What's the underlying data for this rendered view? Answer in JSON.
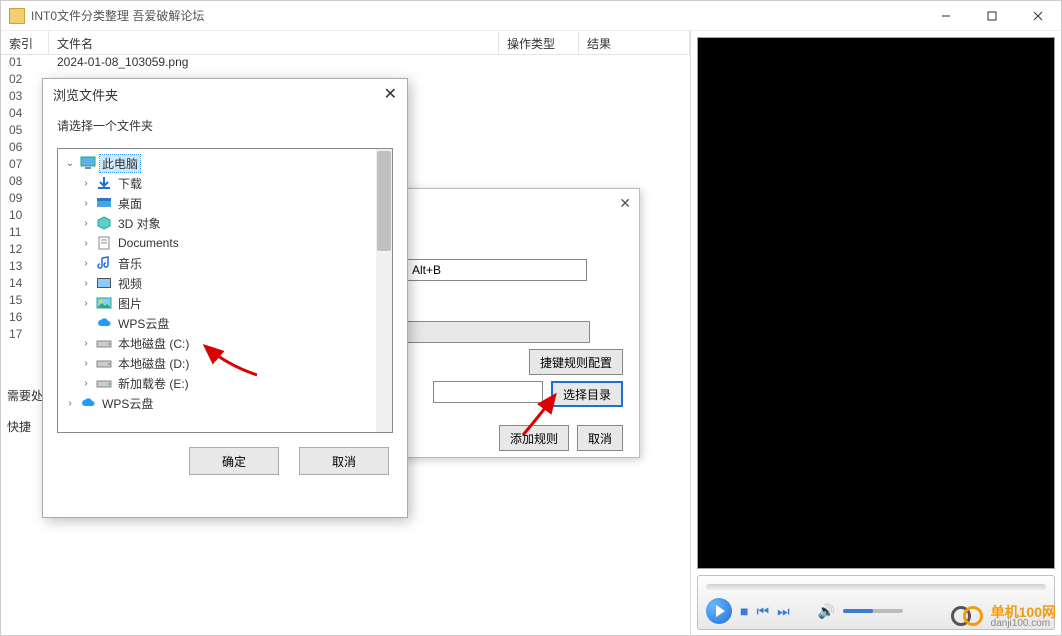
{
  "window": {
    "title": "INT0文件分类整理 吾爱破解论坛"
  },
  "file_table": {
    "headers": {
      "index": "索引",
      "name": "文件名",
      "op": "操作类型",
      "result": "结果"
    },
    "rows": [
      {
        "idx": "01",
        "name": "2024-01-08_103059.png"
      },
      {
        "idx": "02",
        "name": ""
      },
      {
        "idx": "03",
        "name": ""
      },
      {
        "idx": "04",
        "name": ""
      },
      {
        "idx": "05",
        "name": ""
      },
      {
        "idx": "06",
        "name": ""
      },
      {
        "idx": "07",
        "name": ""
      },
      {
        "idx": "08",
        "name": ""
      },
      {
        "idx": "09",
        "name": ""
      },
      {
        "idx": "10",
        "name": ""
      },
      {
        "idx": "11",
        "name": ""
      },
      {
        "idx": "12",
        "name": ""
      },
      {
        "idx": "13",
        "name": ""
      },
      {
        "idx": "14",
        "name": ""
      },
      {
        "idx": "15",
        "name": ""
      },
      {
        "idx": "16",
        "name": ""
      },
      {
        "idx": "17",
        "name": ""
      }
    ]
  },
  "labels": {
    "need_process": "需要处",
    "shortcut": "快捷"
  },
  "under_dialog": {
    "hotkey_value": "Alt+B",
    "rule_config_btn": "捷键规则配置",
    "select_dir_btn": "选择目录",
    "add_rule_btn": "添加规则",
    "cancel_btn": "取消"
  },
  "folder_dialog": {
    "title": "浏览文件夹",
    "subtitle": "请选择一个文件夹",
    "ok": "确定",
    "cancel": "取消",
    "tree": [
      {
        "label": "此电脑",
        "level": 0,
        "expanded": true,
        "icon": "computer",
        "selected": true
      },
      {
        "label": "下载",
        "level": 1,
        "expanded": false,
        "icon": "download"
      },
      {
        "label": "桌面",
        "level": 1,
        "expanded": false,
        "icon": "desktop"
      },
      {
        "label": "3D 对象",
        "level": 1,
        "expanded": false,
        "icon": "3d"
      },
      {
        "label": "Documents",
        "level": 1,
        "expanded": false,
        "icon": "doc"
      },
      {
        "label": "音乐",
        "level": 1,
        "expanded": false,
        "icon": "music"
      },
      {
        "label": "视频",
        "level": 1,
        "expanded": false,
        "icon": "video"
      },
      {
        "label": "图片",
        "level": 1,
        "expanded": false,
        "icon": "pic"
      },
      {
        "label": "WPS云盘",
        "level": 1,
        "expanded": false,
        "icon": "cloud",
        "noexpand": true
      },
      {
        "label": "本地磁盘 (C:)",
        "level": 1,
        "expanded": false,
        "icon": "drive"
      },
      {
        "label": "本地磁盘 (D:)",
        "level": 1,
        "expanded": false,
        "icon": "drive"
      },
      {
        "label": "新加载卷 (E:)",
        "level": 1,
        "expanded": false,
        "icon": "drive"
      },
      {
        "label": "WPS云盘",
        "level": 0,
        "expanded": false,
        "icon": "cloud"
      }
    ]
  },
  "watermark": {
    "cn": "单机100网",
    "en": "danji100.com"
  }
}
